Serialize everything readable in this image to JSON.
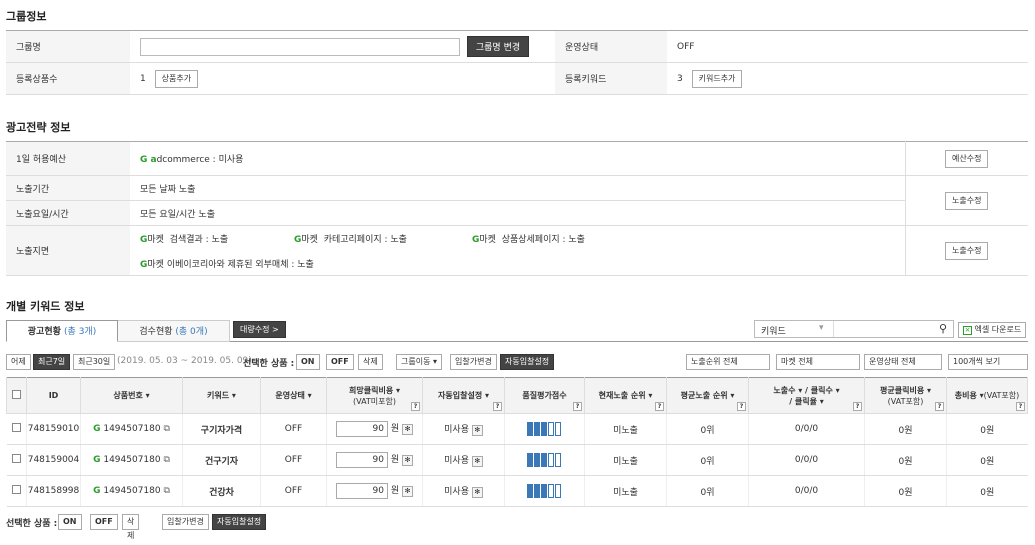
{
  "group": {
    "title": "그룹정보",
    "name_label": "그룹명",
    "name_value": "",
    "rename_btn": "그룹명 변경",
    "status_label": "운영상태",
    "status_value": "OFF",
    "products_label": "등록상품수",
    "products_count": "1",
    "add_product_btn": "상품추가",
    "keywords_label": "등록키워드",
    "keywords_count": "3",
    "add_keyword_btn": "키워드추가"
  },
  "strategy": {
    "title": "광고전략 정보",
    "budget_label": "1일 허용예산",
    "budget_value": "dcommerce  :  미사용",
    "budget_prefix": "G a",
    "budget_btn": "예산수정",
    "period_label": "노출기간",
    "period_value": "모든 날짜 노출",
    "day_label": "노출요일/시간",
    "day_value": "모든 요일/시간 노출",
    "exposure_btn": "노출수정",
    "area_label": "노출지면",
    "area_g": "G",
    "area_market": "마켓",
    "area_1": "검색결과 : 노출",
    "area_2": "카테고리페이지 : 노출",
    "area_3": "상품상세페이지 : 노출",
    "area_4": "이베이코리아와 제휴된 외부매체 : 노출",
    "area_btn": "노출수정"
  },
  "keywords": {
    "title": "개별 키워드 정보",
    "tab1": "광고현황",
    "tab1_count": "(총 3개)",
    "tab2": "검수현황",
    "tab2_count": "(총 0개)",
    "bulk_btn": "대량수정 >",
    "search_select": "키워드",
    "excel_btn": "엑셀 다운로드"
  },
  "toolbar": {
    "yesterday": "어제",
    "last7": "최근7일",
    "last30": "최근30일",
    "range": "(2019. 05. 03 ~ 2019. 05. 09)",
    "selected": "선택한 상품 :",
    "on": "ON",
    "off": "OFF",
    "delete": "삭제",
    "move_group": "그룹이동 ▾",
    "bid_change": "입찰가변경",
    "auto_bid": "자동입찰설정",
    "rank_filter": "노출순위 전체",
    "market_filter": "마켓 전체",
    "status_filter": "운영상태 전체",
    "per_page": "100개씩 보기"
  },
  "columns": {
    "id": "ID",
    "product": "상품번호 ▾",
    "keyword": "키워드 ▾",
    "status": "운영상태 ▾",
    "bid": "희망클릭비용 ▾",
    "bid_sub": "(VAT미포함)",
    "auto": "자동입찰설정 ▾",
    "quality": "품질평가점수",
    "cur_rank": "현재노출 순위 ▾",
    "avg_rank": "평균노출 순위 ▾",
    "imp": "노출수 ▾ / 클릭수 ▾",
    "imp_sub": "/ 클릭율 ▾",
    "avg_cpc": "평균클릭비용 ▾",
    "avg_cpc_sub": "(VAT포함)",
    "total": "총비용 ▾",
    "total_sub": "(VAT포함)"
  },
  "rows": [
    {
      "id": "748159010",
      "product": "1494507180",
      "keyword": "구기자가격",
      "status": "OFF",
      "bid": "90",
      "won": "원",
      "auto": "미사용",
      "quality": 3,
      "cur": "미노출",
      "avg": "0위",
      "imp": "0/0/0",
      "cpc": "0원",
      "total": "0원"
    },
    {
      "id": "748159004",
      "product": "1494507180",
      "keyword": "건구기자",
      "status": "OFF",
      "bid": "90",
      "won": "원",
      "auto": "미사용",
      "quality": 3,
      "cur": "미노출",
      "avg": "0위",
      "imp": "0/0/0",
      "cpc": "0원",
      "total": "0원"
    },
    {
      "id": "748158998",
      "product": "1494507180",
      "keyword": "건강차",
      "status": "OFF",
      "bid": "90",
      "won": "원",
      "auto": "미사용",
      "quality": 3,
      "cur": "미노출",
      "avg": "0위",
      "imp": "0/0/0",
      "cpc": "0원",
      "total": "0원"
    }
  ],
  "bottom": {
    "selected": "선택한 상품 :",
    "on": "ON",
    "off": "OFF",
    "delete": "삭제",
    "bid_change": "입찰가변경",
    "auto_bid": "자동입찰설정"
  }
}
